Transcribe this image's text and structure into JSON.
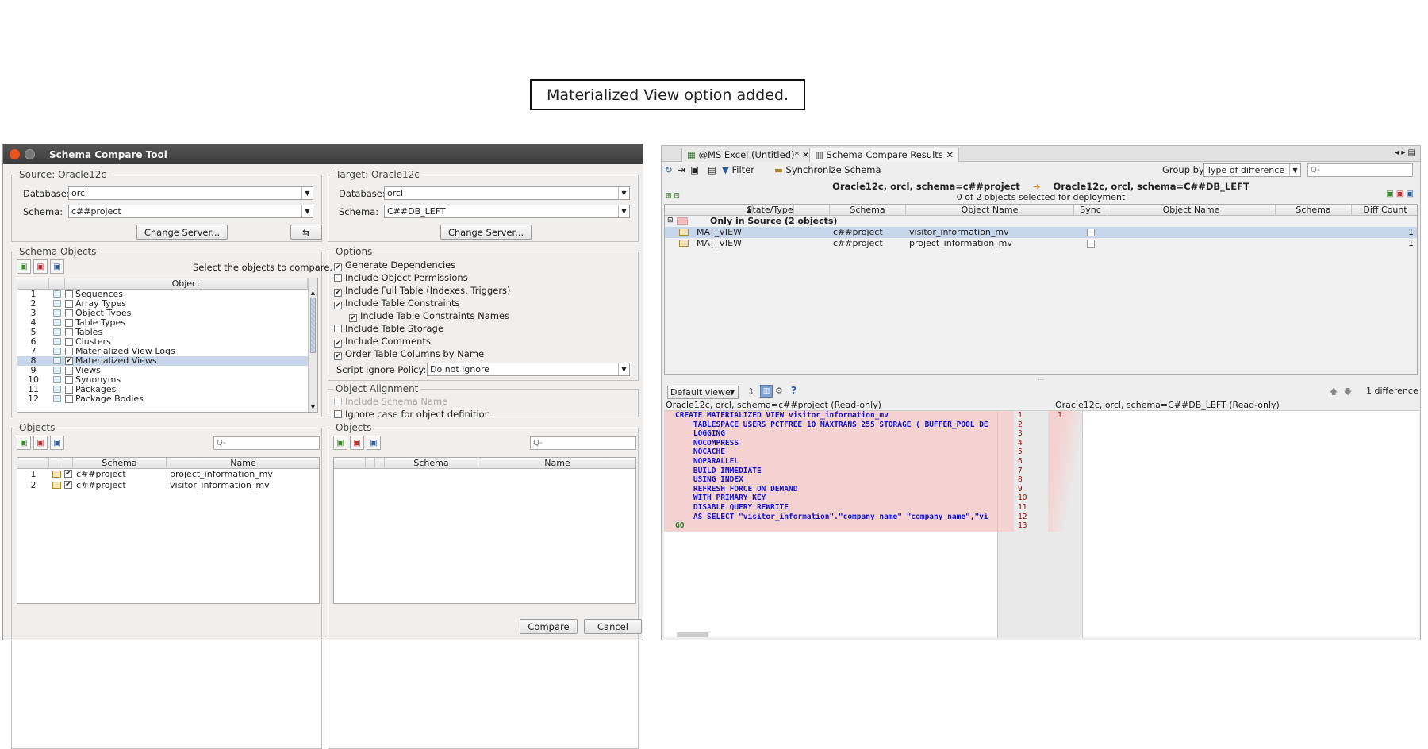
{
  "caption": "Materialized View option added.",
  "dialog": {
    "title": "Schema Compare Tool",
    "source": {
      "legend": "Source: Oracle12c",
      "database_label": "Database:",
      "database_value": "orcl",
      "schema_label": "Schema:",
      "schema_value": "c##project",
      "change_server": "Change Server..."
    },
    "target": {
      "legend": "Target: Oracle12c",
      "database_label": "Database:",
      "database_value": "orcl",
      "schema_label": "Schema:",
      "schema_value": "C##DB_LEFT",
      "change_server": "Change Server..."
    },
    "schema_objects": {
      "legend": "Schema Objects",
      "hint": "Select the objects to compare.",
      "col_object": "Object",
      "items": [
        {
          "n": "1",
          "label": "Sequences",
          "checked": false
        },
        {
          "n": "2",
          "label": "Array Types",
          "checked": false
        },
        {
          "n": "3",
          "label": "Object Types",
          "checked": false
        },
        {
          "n": "4",
          "label": "Table Types",
          "checked": false
        },
        {
          "n": "5",
          "label": "Tables",
          "checked": false
        },
        {
          "n": "6",
          "label": "Clusters",
          "checked": false
        },
        {
          "n": "7",
          "label": "Materialized View Logs",
          "checked": false
        },
        {
          "n": "8",
          "label": "Materialized Views",
          "checked": true
        },
        {
          "n": "9",
          "label": "Views",
          "checked": false
        },
        {
          "n": "10",
          "label": "Synonyms",
          "checked": false
        },
        {
          "n": "11",
          "label": "Packages",
          "checked": false
        },
        {
          "n": "12",
          "label": "Package Bodies",
          "checked": false
        }
      ]
    },
    "options": {
      "legend": "Options",
      "items": [
        {
          "label": "Generate Dependencies",
          "checked": true
        },
        {
          "label": "Include Object Permissions",
          "checked": false
        },
        {
          "label": "Include Full Table (Indexes, Triggers)",
          "checked": true
        },
        {
          "label": "Include Table Constraints",
          "checked": true
        },
        {
          "label": "Include Table Constraints Names",
          "checked": true
        },
        {
          "label": "Include Table Storage",
          "checked": false
        },
        {
          "label": "Include Comments",
          "checked": true
        },
        {
          "label": "Order Table Columns by Name",
          "checked": true
        }
      ],
      "ignore_policy_label": "Script Ignore Policy:",
      "ignore_policy_value": "Do not ignore"
    },
    "alignment": {
      "legend": "Object Alignment",
      "include_schema": "Include Schema Name",
      "ignore_case": "Ignore case for object definition"
    },
    "objects_left": {
      "legend": "Objects",
      "search_placeholder": "Q-",
      "col_schema": "Schema",
      "col_name": "Name",
      "rows": [
        {
          "n": "1",
          "schema": "c##project",
          "name": "project_information_mv"
        },
        {
          "n": "2",
          "schema": "c##project",
          "name": "visitor_information_mv"
        }
      ]
    },
    "objects_right": {
      "legend": "Objects",
      "search_placeholder": "Q-",
      "col_schema": "Schema",
      "col_name": "Name"
    },
    "compare": "Compare",
    "cancel": "Cancel"
  },
  "results": {
    "tabs": [
      "@MS Excel (Untitled)*",
      "Schema Compare Results"
    ],
    "toolbar": {
      "filter": "Filter",
      "sync": "Synchronize Schema",
      "group_by_label": "Group by:",
      "group_by_value": "Type of difference",
      "search_placeholder": "Q-"
    },
    "source_conn": "Oracle12c,  orcl,  schema=c##project",
    "target_conn": "Oracle12c,  orcl,  schema=C##DB_LEFT",
    "selected_info": "0 of 2 objects selected for deployment",
    "columns": {
      "state": "State/Type",
      "schema": "Schema",
      "object_name": "Object Name",
      "sync": "Sync",
      "object_name2": "Object Name",
      "schema2": "Schema",
      "diff_count": "Diff Count"
    },
    "sort_marker": "1",
    "group_label": "Only in Source (2 objects)",
    "rows": [
      {
        "type": "MAT_VIEW",
        "schema": "c##project",
        "name": "visitor_information_mv",
        "diff": "1"
      },
      {
        "type": "MAT_VIEW",
        "schema": "c##project",
        "name": "project_information_mv",
        "diff": "1"
      }
    ],
    "viewer": "Default viewer",
    "diff_count_text": "1 difference",
    "left_header": "Oracle12c, orcl, schema=c##project (Read-only)",
    "right_header": "Oracle12c, orcl, schema=C##DB_LEFT (Read-only)",
    "code_lines": [
      "CREATE MATERIALIZED VIEW visitor_information_mv",
      "    TABLESPACE USERS PCTFREE 10 MAXTRANS 255 STORAGE ( BUFFER_POOL DE",
      "    LOGGING",
      "    NOCOMPRESS",
      "    NOCACHE",
      "    NOPARALLEL",
      "    BUILD IMMEDIATE",
      "    USING INDEX",
      "    REFRESH FORCE ON DEMAND",
      "    WITH PRIMARY KEY",
      "    DISABLE QUERY REWRITE",
      "    AS SELECT \"visitor_information\".\"company name\" \"company name\",\"vi",
      "GO"
    ],
    "gutter_left": [
      "1",
      "2",
      "3",
      "4",
      "5",
      "6",
      "7",
      "8",
      "9",
      "10",
      "11",
      "12",
      "13"
    ],
    "gutter_right": "1"
  }
}
